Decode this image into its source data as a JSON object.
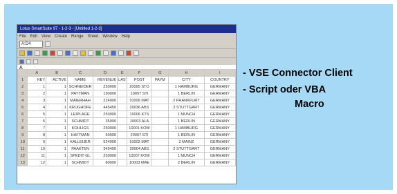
{
  "colors": {
    "panel_background": "#a6d9f5",
    "titlebar": "#1f2f8f",
    "chrome": "#d4d0c8"
  },
  "screenshot": {
    "window_title": "Lotus SmartSuite 97 - 1-2-3 - [Untitled 1-2-3]",
    "menu": [
      "File",
      "Edit",
      "View",
      "Create",
      "Range",
      "Sheet",
      "Window",
      "Help"
    ],
    "cell_address": "A:D4",
    "formula_text": "A",
    "column_headers": [
      "",
      "A",
      "B",
      "C",
      "D",
      "E",
      "F",
      "G",
      "H",
      "I"
    ],
    "rows": [
      [
        "1",
        "KEY",
        "ACTIVE",
        "NAME",
        "REVENUE",
        "LAST",
        "POST",
        "PAYM",
        "CITY",
        "COUNTRY"
      ],
      [
        "2",
        "1",
        "1",
        "SCHNEIDER",
        "250000",
        "",
        "20095 STO",
        "",
        "1 HAMBURG",
        "GERMANY"
      ],
      [
        "3",
        "2",
        "1",
        "PATTMAN",
        "190000",
        "",
        "10097 STI",
        "",
        "1 BERLIN",
        "GERMANY"
      ],
      [
        "4",
        "3",
        "1",
        "MAIERHAH",
        "224000",
        "",
        "10006 MAT",
        "",
        "2 FRANKFURT",
        "GERMANY"
      ],
      [
        "5",
        "4",
        "1",
        "KRUGHOFE",
        "445450",
        "",
        "20036 ABS",
        "",
        "2 STUTTGART",
        "GERMANY"
      ],
      [
        "6",
        "5",
        "1",
        "LEIPLAGE",
        "250000",
        "",
        "10006 KTS",
        "",
        "1 MUNCH",
        "GERMANY"
      ],
      [
        "7",
        "6",
        "1",
        "SCHMIDT",
        "35000",
        "",
        "10003 ALA",
        "",
        "1 BERLIN",
        "GERMANY"
      ],
      [
        "8",
        "7",
        "1",
        "KOHLIGS",
        "250000",
        "",
        "10001 KOW",
        "",
        "1 HAMBURG",
        "GERMANY"
      ],
      [
        "9",
        "8",
        "1",
        "HAFTMAN",
        "50000",
        "",
        "20097 STI",
        "",
        "1 BERLIN",
        "GERMANY"
      ],
      [
        "10",
        "9",
        "1",
        "KALLEIJER",
        "524000",
        "",
        "10002 MAT",
        "",
        "2 MAINZ",
        "GERMANY"
      ],
      [
        "11",
        "10",
        "1",
        "PAAKTEN",
        "345450",
        "",
        "20004 ABS",
        "",
        "2 STUTTGART",
        "GERMANY"
      ],
      [
        "12",
        "11",
        "1",
        "SPEDIT GL",
        "250000",
        "",
        "10007 KOW",
        "",
        "1 MUNCH",
        "GERMANY"
      ],
      [
        "13",
        "12",
        "1",
        "SCHMIDT",
        "80000",
        "",
        "10003 MAE",
        "",
        "2 BERLIN",
        "GERMANY"
      ]
    ]
  },
  "bullets": {
    "line1": "- VSE Connector Client",
    "line2": "- Script oder VBA",
    "line3": "Macro"
  }
}
